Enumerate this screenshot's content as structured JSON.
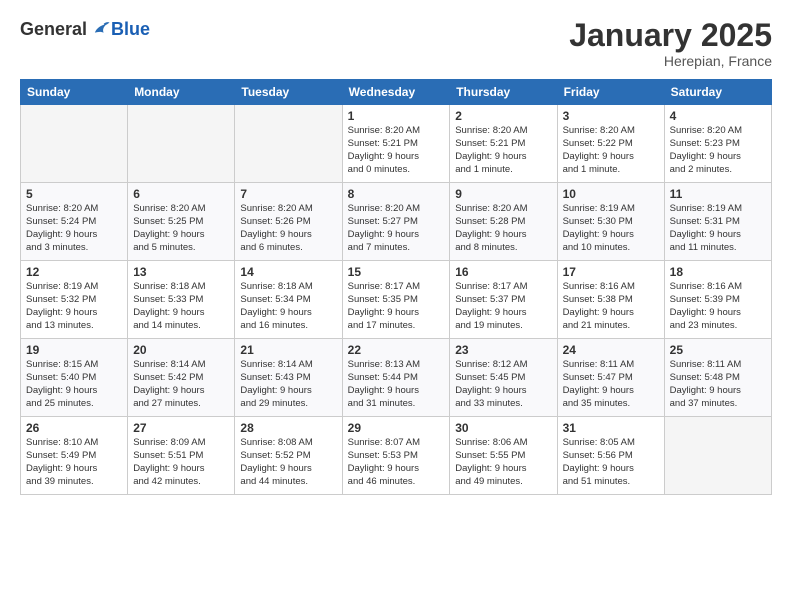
{
  "logo": {
    "general": "General",
    "blue": "Blue"
  },
  "title": "January 2025",
  "subtitle": "Herepian, France",
  "weekdays": [
    "Sunday",
    "Monday",
    "Tuesday",
    "Wednesday",
    "Thursday",
    "Friday",
    "Saturday"
  ],
  "weeks": [
    [
      {
        "day": "",
        "info": ""
      },
      {
        "day": "",
        "info": ""
      },
      {
        "day": "",
        "info": ""
      },
      {
        "day": "1",
        "info": "Sunrise: 8:20 AM\nSunset: 5:21 PM\nDaylight: 9 hours\nand 0 minutes."
      },
      {
        "day": "2",
        "info": "Sunrise: 8:20 AM\nSunset: 5:21 PM\nDaylight: 9 hours\nand 1 minute."
      },
      {
        "day": "3",
        "info": "Sunrise: 8:20 AM\nSunset: 5:22 PM\nDaylight: 9 hours\nand 1 minute."
      },
      {
        "day": "4",
        "info": "Sunrise: 8:20 AM\nSunset: 5:23 PM\nDaylight: 9 hours\nand 2 minutes."
      }
    ],
    [
      {
        "day": "5",
        "info": "Sunrise: 8:20 AM\nSunset: 5:24 PM\nDaylight: 9 hours\nand 3 minutes."
      },
      {
        "day": "6",
        "info": "Sunrise: 8:20 AM\nSunset: 5:25 PM\nDaylight: 9 hours\nand 5 minutes."
      },
      {
        "day": "7",
        "info": "Sunrise: 8:20 AM\nSunset: 5:26 PM\nDaylight: 9 hours\nand 6 minutes."
      },
      {
        "day": "8",
        "info": "Sunrise: 8:20 AM\nSunset: 5:27 PM\nDaylight: 9 hours\nand 7 minutes."
      },
      {
        "day": "9",
        "info": "Sunrise: 8:20 AM\nSunset: 5:28 PM\nDaylight: 9 hours\nand 8 minutes."
      },
      {
        "day": "10",
        "info": "Sunrise: 8:19 AM\nSunset: 5:30 PM\nDaylight: 9 hours\nand 10 minutes."
      },
      {
        "day": "11",
        "info": "Sunrise: 8:19 AM\nSunset: 5:31 PM\nDaylight: 9 hours\nand 11 minutes."
      }
    ],
    [
      {
        "day": "12",
        "info": "Sunrise: 8:19 AM\nSunset: 5:32 PM\nDaylight: 9 hours\nand 13 minutes."
      },
      {
        "day": "13",
        "info": "Sunrise: 8:18 AM\nSunset: 5:33 PM\nDaylight: 9 hours\nand 14 minutes."
      },
      {
        "day": "14",
        "info": "Sunrise: 8:18 AM\nSunset: 5:34 PM\nDaylight: 9 hours\nand 16 minutes."
      },
      {
        "day": "15",
        "info": "Sunrise: 8:17 AM\nSunset: 5:35 PM\nDaylight: 9 hours\nand 17 minutes."
      },
      {
        "day": "16",
        "info": "Sunrise: 8:17 AM\nSunset: 5:37 PM\nDaylight: 9 hours\nand 19 minutes."
      },
      {
        "day": "17",
        "info": "Sunrise: 8:16 AM\nSunset: 5:38 PM\nDaylight: 9 hours\nand 21 minutes."
      },
      {
        "day": "18",
        "info": "Sunrise: 8:16 AM\nSunset: 5:39 PM\nDaylight: 9 hours\nand 23 minutes."
      }
    ],
    [
      {
        "day": "19",
        "info": "Sunrise: 8:15 AM\nSunset: 5:40 PM\nDaylight: 9 hours\nand 25 minutes."
      },
      {
        "day": "20",
        "info": "Sunrise: 8:14 AM\nSunset: 5:42 PM\nDaylight: 9 hours\nand 27 minutes."
      },
      {
        "day": "21",
        "info": "Sunrise: 8:14 AM\nSunset: 5:43 PM\nDaylight: 9 hours\nand 29 minutes."
      },
      {
        "day": "22",
        "info": "Sunrise: 8:13 AM\nSunset: 5:44 PM\nDaylight: 9 hours\nand 31 minutes."
      },
      {
        "day": "23",
        "info": "Sunrise: 8:12 AM\nSunset: 5:45 PM\nDaylight: 9 hours\nand 33 minutes."
      },
      {
        "day": "24",
        "info": "Sunrise: 8:11 AM\nSunset: 5:47 PM\nDaylight: 9 hours\nand 35 minutes."
      },
      {
        "day": "25",
        "info": "Sunrise: 8:11 AM\nSunset: 5:48 PM\nDaylight: 9 hours\nand 37 minutes."
      }
    ],
    [
      {
        "day": "26",
        "info": "Sunrise: 8:10 AM\nSunset: 5:49 PM\nDaylight: 9 hours\nand 39 minutes."
      },
      {
        "day": "27",
        "info": "Sunrise: 8:09 AM\nSunset: 5:51 PM\nDaylight: 9 hours\nand 42 minutes."
      },
      {
        "day": "28",
        "info": "Sunrise: 8:08 AM\nSunset: 5:52 PM\nDaylight: 9 hours\nand 44 minutes."
      },
      {
        "day": "29",
        "info": "Sunrise: 8:07 AM\nSunset: 5:53 PM\nDaylight: 9 hours\nand 46 minutes."
      },
      {
        "day": "30",
        "info": "Sunrise: 8:06 AM\nSunset: 5:55 PM\nDaylight: 9 hours\nand 49 minutes."
      },
      {
        "day": "31",
        "info": "Sunrise: 8:05 AM\nSunset: 5:56 PM\nDaylight: 9 hours\nand 51 minutes."
      },
      {
        "day": "",
        "info": ""
      }
    ]
  ]
}
